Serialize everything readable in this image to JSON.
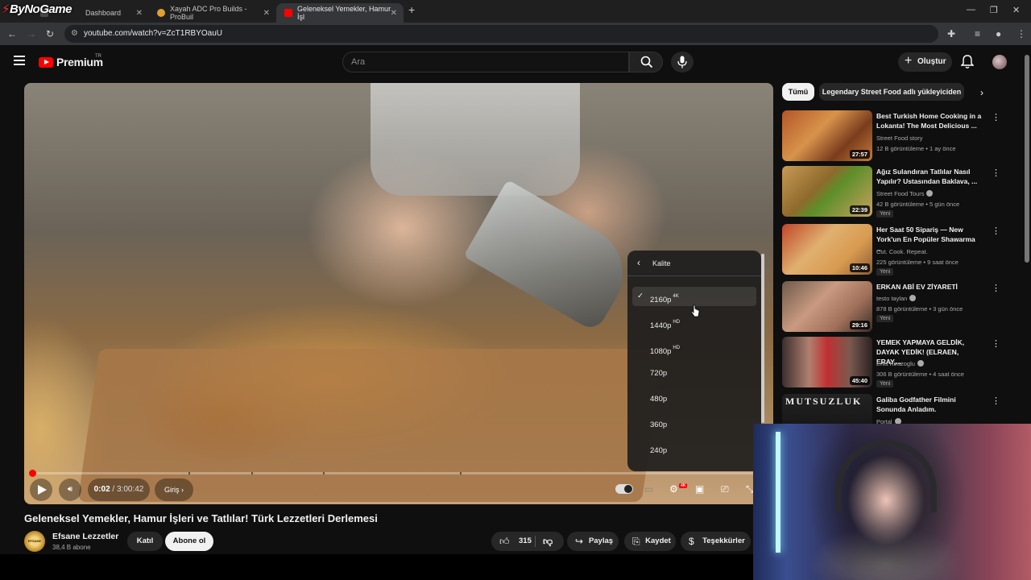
{
  "browser": {
    "tabs": [
      {
        "label": "Dashboard",
        "favicon_color": "#4a4a4a"
      },
      {
        "label": "Xayah ADC Pro Builds - ProBuil",
        "favicon_color": "#e0a030"
      },
      {
        "label": "Geleneksel Yemekler, Hamur İşl",
        "favicon_color": "#ff0000"
      }
    ],
    "url": "youtube.com/watch?v=ZcT1RBYOauU",
    "overlay_logo": "ByNoGame"
  },
  "header": {
    "brand": "Premium",
    "region": "TR",
    "search_placeholder": "Ara",
    "create_label": "Oluştur"
  },
  "player": {
    "current_time": "0:02",
    "duration": "3:00:42",
    "chapter_label": "Giriş",
    "progress_fraction": 0.0011,
    "quality_menu": {
      "title": "Kalite",
      "selected": "2160p",
      "options": [
        {
          "label": "2160p",
          "badge": "4K"
        },
        {
          "label": "1440p",
          "badge": "HD"
        },
        {
          "label": "1080p",
          "badge": "HD"
        },
        {
          "label": "720p",
          "badge": ""
        },
        {
          "label": "480p",
          "badge": ""
        },
        {
          "label": "360p",
          "badge": ""
        },
        {
          "label": "240p",
          "badge": ""
        }
      ]
    },
    "settings_badge": "4K"
  },
  "video": {
    "title": "Geleneksel Yemekler, Hamur İşleri ve Tatlılar! Türk Lezzetleri Derlemesi",
    "channel": "Efsane Lezzetler",
    "channel_avatar_text": "EFSANE FOOD",
    "subscribers": "38,4 B abone",
    "join_label": "Katıl",
    "subscribe_label": "Abone ol",
    "likes": "315",
    "share_label": "Paylaş",
    "save_label": "Kaydet",
    "thanks_label": "Teşekkürler"
  },
  "sidebar": {
    "chips": [
      "Tümü",
      "Legendary Street Food adlı yükleyiciden"
    ],
    "recommendations": [
      {
        "title": "Best Turkish Home Cooking in a Lokanta! The Most Delicious ...",
        "channel": "Street Food story",
        "verified": false,
        "meta": "12 B görüntüleme • 1 ay önce",
        "duration": "27:57",
        "badge": "",
        "thumb": "linear-gradient(135deg,#b4552a,#d8934b 40%,#7a3c1c 70%,#c47a3a)"
      },
      {
        "title": "Ağız Sulandıran Tatlılar Nasıl Yapılır? Ustasından Baklava, ...",
        "channel": "Street Food Tours",
        "verified": true,
        "meta": "42 B görüntüleme • 5 gün önce",
        "duration": "22:39",
        "badge": "Yeni",
        "thumb": "linear-gradient(135deg,#c89a55,#8e6a2c 40%,#5d8f2a 55%,#c9a15f)"
      },
      {
        "title": "Her Saat 50 Sipariş — New York'un En Popüler Shawarma ...",
        "channel": "Cut. Cook. Repeat.",
        "verified": false,
        "meta": "225 görüntüleme • 9 saat önce",
        "duration": "10:46",
        "badge": "Yeni",
        "thumb": "linear-gradient(135deg,#c0462a,#e0b070 40%,#d89a50 70%,#8a5a30)"
      },
      {
        "title": "ERKAN ABİ EV ZİYARETİ",
        "channel": "testo taylan",
        "verified": true,
        "meta": "878 B görüntüleme • 3 gün önce",
        "duration": "29:16",
        "badge": "Yeni",
        "thumb": "linear-gradient(135deg,#6f5a4c,#c99a80 40%,#a0705a 70%,#3a2c26)"
      },
      {
        "title": "YEMEK YAPMAYA GELDİK, DAYAK YEDİK! (ELRAEN, ERAY,...",
        "channel": "Enis Kirazoglu",
        "verified": true,
        "meta": "306 B görüntüleme • 4 saat önce",
        "duration": "45:40",
        "badge": "Yeni",
        "thumb": "linear-gradient(90deg,#3a2f2e,#b08070 30%,#c03030 50%,#7a5a50 75%,#2a2222)"
      },
      {
        "title": "Galiba Godfather Filmini Sonunda Anladım.",
        "channel": "Portal",
        "verified": true,
        "meta": "",
        "duration": "",
        "badge": "",
        "thumb": "linear-gradient(180deg,#222 0%,#111 100%)",
        "overlay_text": "MUTSUZLUK"
      }
    ]
  }
}
